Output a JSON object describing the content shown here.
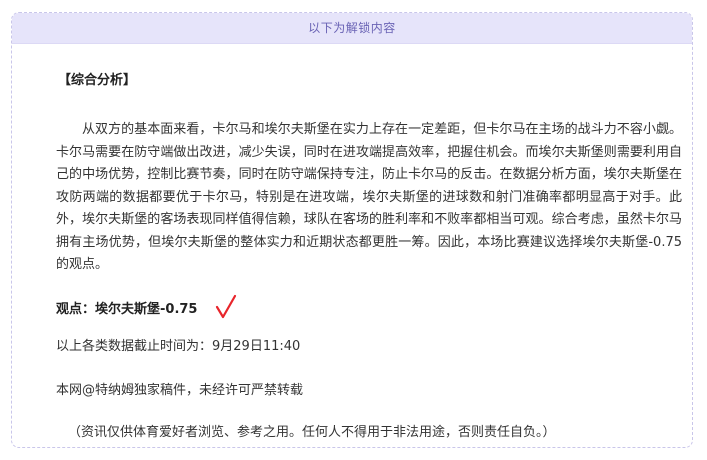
{
  "header": {
    "unlock_label": "以下为解锁内容"
  },
  "article": {
    "section_title": "【综合分析】",
    "analysis_text": "从双方的基本面来看，卡尔马和埃尔夫斯堡在实力上存在一定差距，但卡尔马在主场的战斗力不容小觑。卡尔马需要在防守端做出改进，减少失误，同时在进攻端提高效率，把握住机会。而埃尔夫斯堡则需要利用自己的中场优势，控制比赛节奏，同时在防守端保持专注，防止卡尔马的反击。在数据分析方面，埃尔夫斯堡在攻防两端的数据都要优于卡尔马，特别是在进攻端，埃尔夫斯堡的进球数和射门准确率都明显高于对手。此外，埃尔夫斯堡的客场表现同样值得信赖，球队在客场的胜利率和不败率都相当可观。综合考虑，虽然卡尔马拥有主场优势，但埃尔夫斯堡的整体实力和近期状态都更胜一筹。因此，本场比赛建议选择埃尔夫斯堡-0.75的观点。",
    "viewpoint": "观点：埃尔夫斯堡-0.75",
    "check_color": "#e8252b",
    "cutoff_time": "以上各类数据截止时间为：9月29日11:40",
    "copyright": "本网@特纳姆独家稿件，未经许可严禁转载",
    "disclaimer": "（资讯仅供体育爱好者浏览、参考之用。任何人不得用于非法用途，否则责任自负。）"
  },
  "colors": {
    "header_bg": "#e6e4fa",
    "header_text": "#6a63b5",
    "border": "#c9c6ea"
  }
}
